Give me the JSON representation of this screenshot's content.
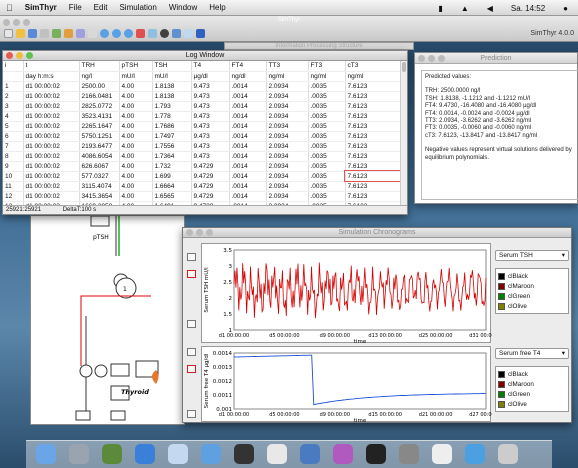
{
  "menubar": {
    "apple": "",
    "items": [
      "SimThyr",
      "File",
      "Edit",
      "Simulation",
      "Window",
      "Help"
    ],
    "clock": "Sa. 14:52"
  },
  "appwindow": {
    "title": "SimThyr",
    "version": "SimThyr 4.0.0"
  },
  "background_title": "Information Processing Structure",
  "logwindow": {
    "title": "Log Window",
    "headers": [
      "i",
      "t",
      "TRH",
      "pTSH",
      "TSH",
      "T4",
      "FT4",
      "TT3",
      "FT3",
      "cT3"
    ],
    "units": [
      "",
      "day h:m:s",
      "ng/l",
      "mU/l",
      "mU/l",
      "µg/dl",
      "ng/dl",
      "ng/ml",
      "ng/ml",
      "ng/ml"
    ],
    "rows": [
      [
        "1",
        "d1 00:00:02",
        "2500.00",
        "4.00",
        "1.8138",
        "9.473",
        ".0014",
        "2.0934",
        ".0035",
        "7.6123"
      ],
      [
        "2",
        "d1 00:00:02",
        "2166.0481",
        "4.00",
        "1.8138",
        "9.473",
        ".0014",
        "2.0934",
        ".0035",
        "7.6123"
      ],
      [
        "3",
        "d1 00:00:02",
        "2825.0772",
        "4.00",
        "1.793",
        "9.473",
        ".0014",
        "2.0934",
        ".0035",
        "7.6123"
      ],
      [
        "4",
        "d1 00:00:02",
        "3523.4131",
        "4.00",
        "1.778",
        "9.473",
        ".0014",
        "2.0934",
        ".0035",
        "7.6123"
      ],
      [
        "5",
        "d1 00:00:02",
        "2265.1647",
        "4.00",
        "1.7686",
        "9.473",
        ".0014",
        "2.0934",
        ".0035",
        "7.6123"
      ],
      [
        "6",
        "d1 00:00:02",
        "5750.1251",
        "4.00",
        "1.7497",
        "9.473",
        ".0014",
        "2.0934",
        ".0035",
        "7.6123"
      ],
      [
        "7",
        "d1 00:00:02",
        "2193.6477",
        "4.00",
        "1.7556",
        "9.473",
        ".0014",
        "2.0934",
        ".0035",
        "7.6123"
      ],
      [
        "8",
        "d1 00:00:02",
        "4086.6054",
        "4.00",
        "1.7364",
        "9.473",
        ".0014",
        "2.0934",
        ".0035",
        "7.6123"
      ],
      [
        "9",
        "d1 00:00:02",
        "626.6067",
        "4.00",
        "1.732",
        "9.4729",
        ".0014",
        "2.0934",
        ".0035",
        "7.6123"
      ],
      [
        "10",
        "d1 00:00:02",
        "577.0327",
        "4.00",
        "1.699",
        "9.4729",
        ".0014",
        "2.0934",
        ".0035",
        "7.6123"
      ],
      [
        "11",
        "d1 00:00:02",
        "3115.4074",
        "4.00",
        "1.6664",
        "9.4729",
        ".0014",
        "2.0934",
        ".0035",
        "7.6123"
      ],
      [
        "12",
        "d1 00:00:02",
        "3415.3654",
        "4.00",
        "1.6565",
        "9.4729",
        ".0014",
        "2.0934",
        ".0035",
        "7.6123"
      ],
      [
        "13",
        "d1 00:00:02",
        "1669.3058",
        "4.00",
        "1.6491",
        "9.4728",
        ".0014",
        "2.0934",
        ".0035",
        "7.6123"
      ]
    ],
    "status_left": "25921:25921",
    "status_right": "DeltaT:100 s"
  },
  "prediction": {
    "title": "Prediction",
    "heading": "Predicted values:",
    "lines": [
      "TRH: 2500.0000 ng/l",
      "TSH: 1.8138, -1.1212 and -1.1212 mU/l",
      "FT4: 9.4730, -16.4080 and -16.4080 µg/dl",
      "FT4: 0.0014, -0.0024 and -0.0024 µg/dl",
      "TT3: 2.0934, -3.6262 and -3.6262 ng/ml",
      "FT3: 0.0035, -0.0060 and -0.0060 ng/ml",
      "cT3: 7.6123, -13.8417 and -13.8417 ng/ml"
    ],
    "note": "Negative values represent virtual solutions delivered by equilibrium polynomials."
  },
  "simulation": {
    "title": "Simulation Chronograms",
    "plot1": {
      "ylabel": "Serum TSH mU/l",
      "xlabel": "time",
      "xticks": [
        "d1 00:00:00",
        "d5 00:00:00",
        "d9 00:00:00",
        "d13 00:00:00",
        "d25 00:00:00",
        "d31 00:00:00"
      ],
      "yticks": [
        "3.5",
        "3",
        "2.5",
        "2",
        "1.5",
        "1"
      ],
      "select": "Serum TSH"
    },
    "plot2": {
      "ylabel": "Serum free T4 µg/dl",
      "xlabel": "time",
      "xticks": [
        "d1 00:00:00",
        "d5 00:00:00",
        "d9 00:00:00",
        "d15 00:00:00",
        "d21 00:00:00",
        "d27 00:00:00"
      ],
      "yticks": [
        "0.0014",
        "0.0013",
        "0.0012",
        "0.0011",
        "0.001"
      ],
      "select": "Serum free T4"
    },
    "legend": [
      {
        "name": "clBlack",
        "color": "#000000"
      },
      {
        "name": "clMaroon",
        "color": "#800000"
      },
      {
        "name": "clGreen",
        "color": "#008000"
      },
      {
        "name": "clOlive",
        "color": "#808000"
      }
    ]
  },
  "blockdiagram": {
    "label": "Thyroid",
    "pTSH_label": "pTSH"
  },
  "dock_icons": [
    "finder",
    "rocket",
    "system",
    "safari",
    "preview",
    "help",
    "terminal",
    "ical",
    "iphoto",
    "itunes",
    "activity",
    "settings",
    "textedit",
    "zoom",
    "trash"
  ]
}
